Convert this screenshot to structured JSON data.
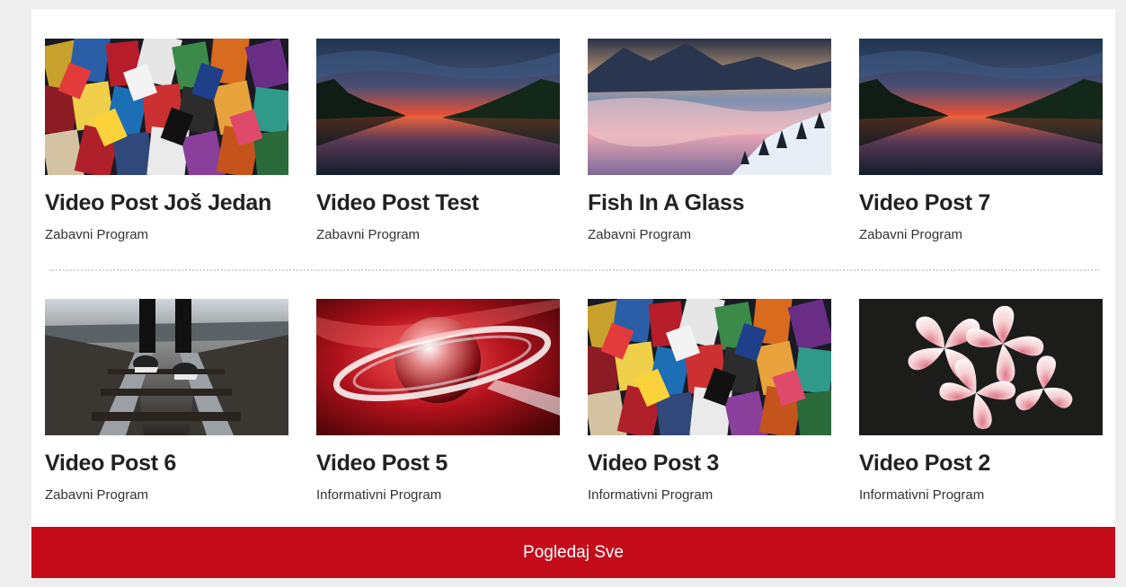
{
  "posts_row1": [
    {
      "title": "Video Post Još Jedan",
      "category": "Zabavni Program",
      "thumbnail": "collage"
    },
    {
      "title": "Video Post Test",
      "category": "Zabavni Program",
      "thumbnail": "sunset-lake"
    },
    {
      "title": "Fish In A Glass",
      "category": "Zabavni Program",
      "thumbnail": "misty-mountains"
    },
    {
      "title": "Video Post 7",
      "category": "Zabavni Program",
      "thumbnail": "sunset-lake"
    }
  ],
  "posts_row2": [
    {
      "title": "Video Post 6",
      "category": "Zabavni Program",
      "thumbnail": "railway-feet"
    },
    {
      "title": "Video Post 5",
      "category": "Informativni Program",
      "thumbnail": "red-globe"
    },
    {
      "title": "Video Post 3",
      "category": "Informativni Program",
      "thumbnail": "collage"
    },
    {
      "title": "Video Post 2",
      "category": "Informativni Program",
      "thumbnail": "pink-flowers"
    }
  ],
  "view_all_label": "Pogledaj Sve",
  "colors": {
    "accent": "#c30b1a",
    "title": "#222222",
    "page_bg": "#eeeeee"
  }
}
